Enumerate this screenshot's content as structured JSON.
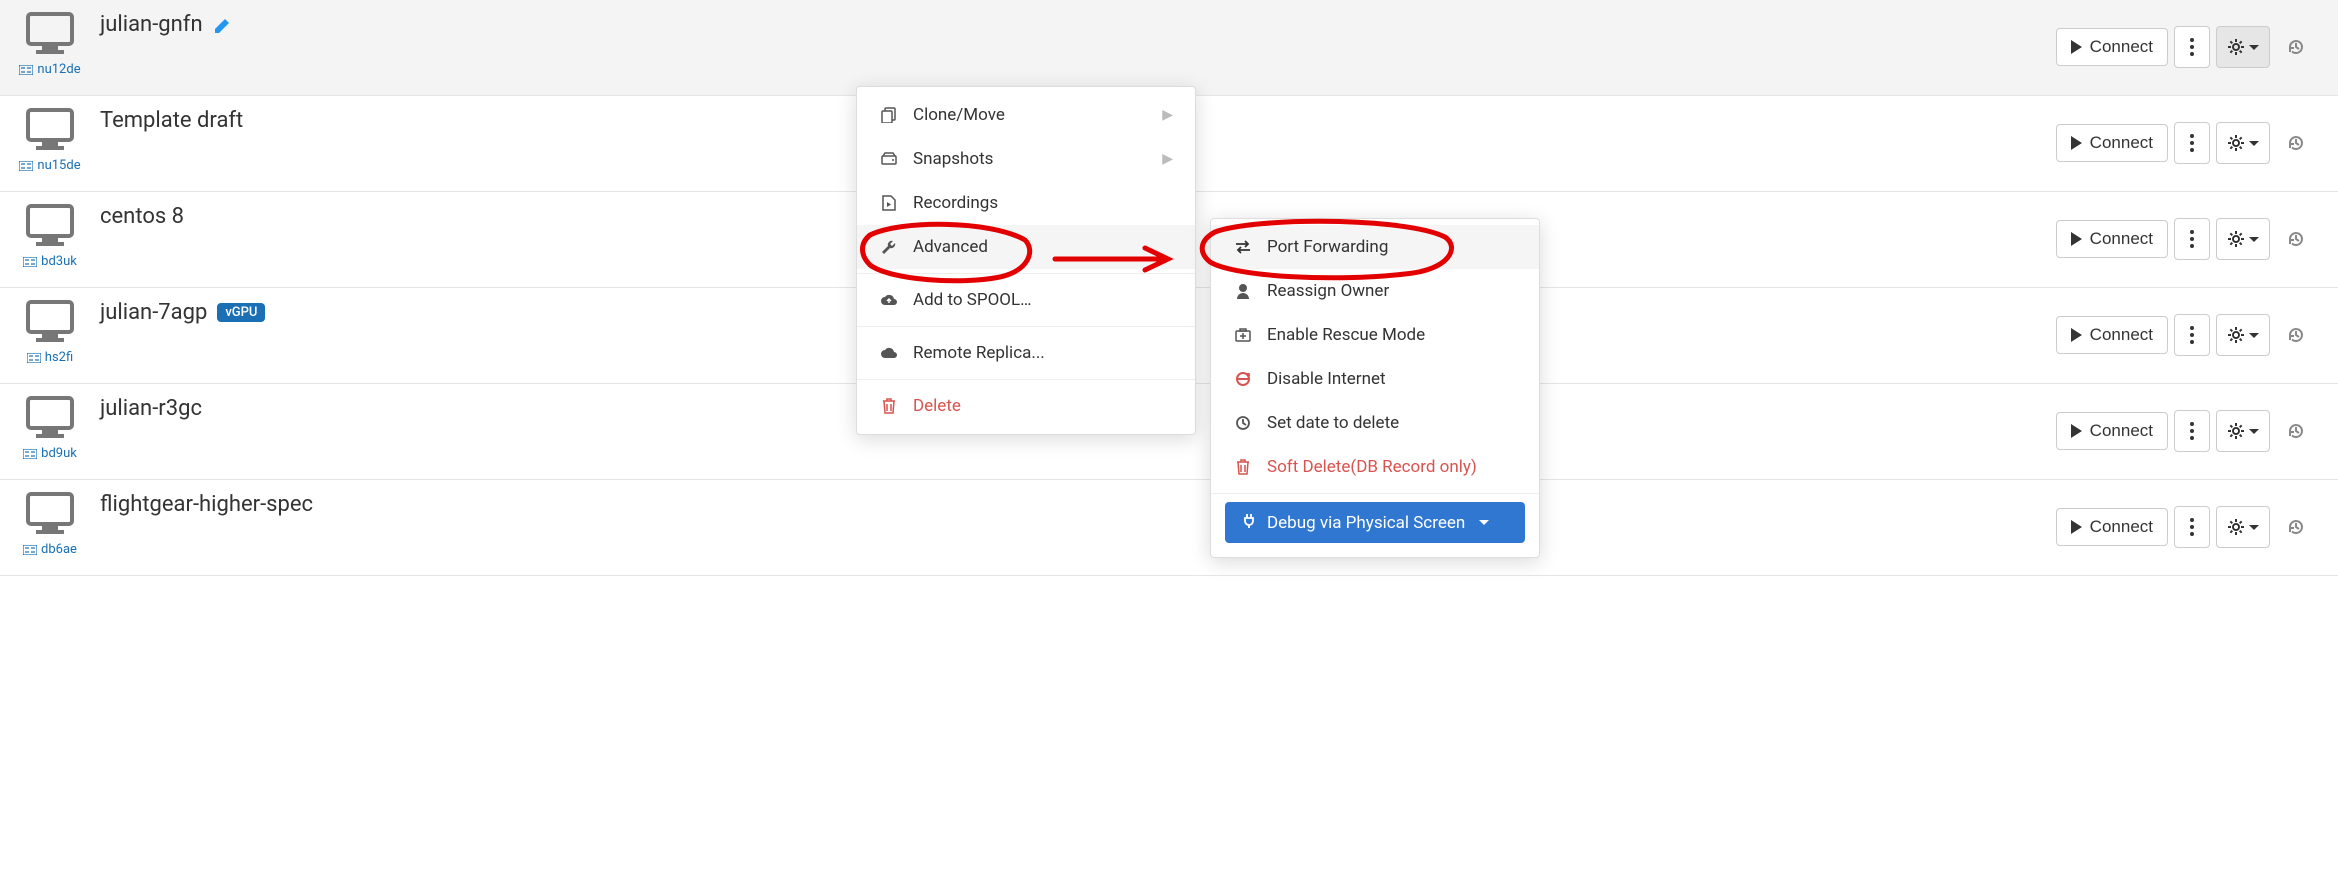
{
  "connect_label": "Connect",
  "vms": [
    {
      "name": "julian-gnfn",
      "node": "nu12de",
      "editable": true,
      "selected": true,
      "gear_open": true
    },
    {
      "name": "Template draft",
      "node": "nu15de",
      "editable": false,
      "selected": false,
      "gear_open": false
    },
    {
      "name": "centos 8",
      "node": "bd3uk",
      "editable": false,
      "selected": false,
      "gear_open": false
    },
    {
      "name": "julian-7agp",
      "node": "hs2fi",
      "editable": false,
      "selected": false,
      "gear_open": false,
      "badge": "vGPU"
    },
    {
      "name": "julian-r3gc",
      "node": "bd9uk",
      "editable": false,
      "selected": false,
      "gear_open": false
    },
    {
      "name": "flightgear-higher-spec",
      "node": "db6ae",
      "editable": false,
      "selected": false,
      "gear_open": false
    }
  ],
  "menu_primary": {
    "clone": "Clone/Move",
    "snapshots": "Snapshots",
    "recordings": "Recordings",
    "advanced": "Advanced",
    "add_spool": "Add to SPOOL…",
    "remote_replica": "Remote Replica...",
    "delete": "Delete"
  },
  "menu_advanced": {
    "port_forwarding": "Port Forwarding",
    "reassign_owner": "Reassign Owner",
    "rescue_mode": "Enable Rescue Mode",
    "disable_internet": "Disable Internet",
    "set_date_delete": "Set date to delete",
    "soft_delete": "Soft Delete(DB Record only)",
    "debug_physical": "Debug via Physical Screen"
  }
}
